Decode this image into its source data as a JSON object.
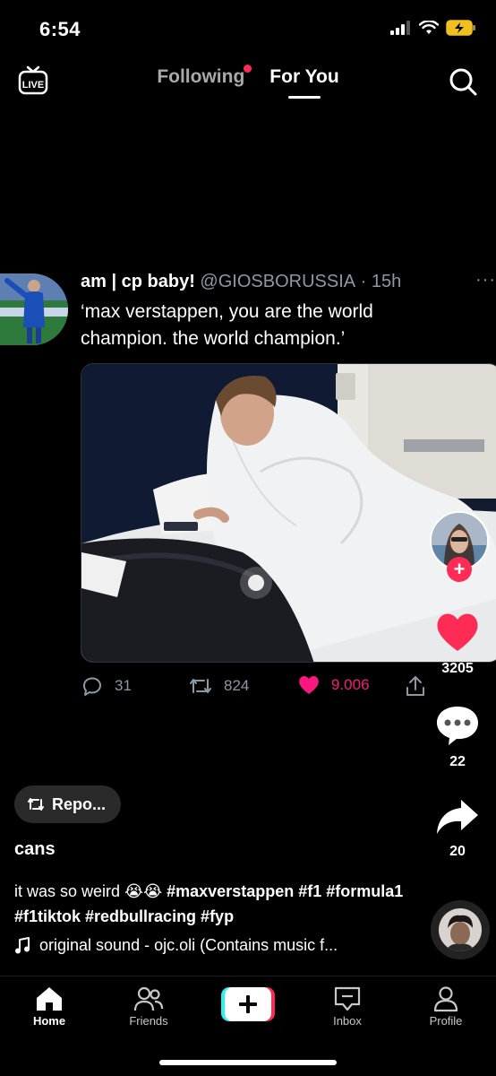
{
  "status": {
    "time": "6:54"
  },
  "top_nav": {
    "live_label": "LIVE",
    "tabs": [
      {
        "label": "Following",
        "active": false,
        "has_dot": true
      },
      {
        "label": "For You",
        "active": true
      }
    ]
  },
  "tweet": {
    "display_name": "am | cp baby!",
    "handle": "@GIOSBORUSSIA",
    "age": "· 15h",
    "more": "···",
    "text": "‘max verstappen, you are the world champion. the world champion.’",
    "replies": "31",
    "retweets": "824",
    "likes": "9.006"
  },
  "rail": {
    "likes": "3205",
    "comments": "22",
    "shares": "20"
  },
  "caption": {
    "repost_label": "Repo...",
    "author": "cans",
    "text": "it was so weird 😭😭",
    "hashtags": "#maxverstappen #f1 #formula1 #f1tiktok #redbullracing #fyp",
    "sound": "original sound - ojc.oli (Contains music f..."
  },
  "bottom_nav": {
    "items": [
      {
        "label": "Home"
      },
      {
        "label": "Friends"
      },
      {
        "label": "Inbox"
      },
      {
        "label": "Profile"
      }
    ]
  },
  "colors": {
    "accent": "#fe2c55",
    "muted": "#8b98a5",
    "background": "#000000"
  }
}
